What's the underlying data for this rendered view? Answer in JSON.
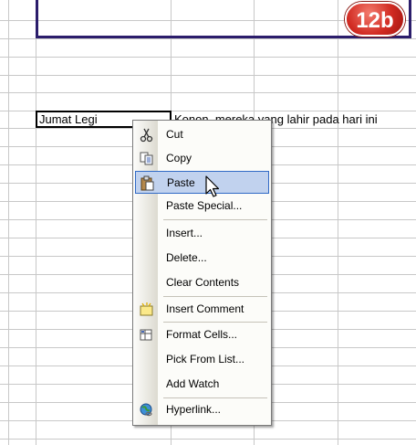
{
  "badge": {
    "label": "12b"
  },
  "sheet": {
    "active_cell_value": "Jumat Legi",
    "adjacent_cell_text": "Konon, mereka yang lahir pada hari ini"
  },
  "context_menu": {
    "items": [
      {
        "label": "Cut",
        "icon": "scissors-icon"
      },
      {
        "label": "Copy",
        "icon": "copy-icon"
      },
      {
        "label": "Paste",
        "icon": "clipboard-icon",
        "selected": true
      },
      {
        "label": "Paste Special...",
        "icon": ""
      },
      {
        "label": "Insert...",
        "icon": ""
      },
      {
        "label": "Delete...",
        "icon": ""
      },
      {
        "label": "Clear Contents",
        "icon": ""
      },
      {
        "label": "Insert Comment",
        "icon": "comment-icon"
      },
      {
        "label": "Format Cells...",
        "icon": "format-cells-icon"
      },
      {
        "label": "Pick From List...",
        "icon": ""
      },
      {
        "label": "Add Watch",
        "icon": ""
      },
      {
        "label": "Hyperlink...",
        "icon": "globe-link-icon"
      }
    ]
  },
  "colors": {
    "title_border": "#2b1d6b",
    "badge_red": "#d12b22",
    "menu_highlight": "#c1d2ee",
    "menu_highlight_border": "#316ac5"
  }
}
